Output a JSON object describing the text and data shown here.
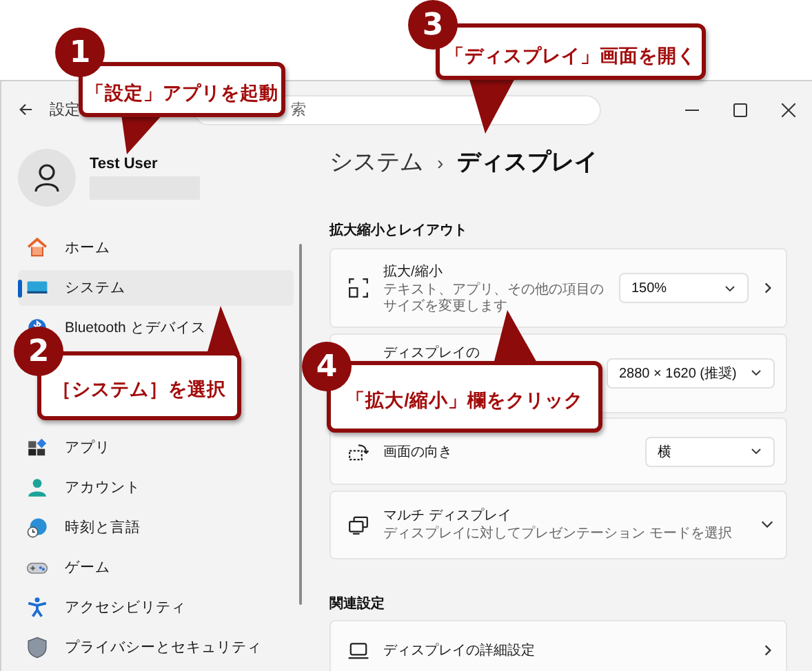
{
  "window": {
    "title": "設定",
    "search": {
      "placeholder": "索"
    }
  },
  "user": {
    "name": "Test User"
  },
  "breadcrumb": {
    "parent": "システム",
    "separator": "›",
    "current": "ディスプレイ"
  },
  "nav": [
    {
      "label": "ホーム",
      "selected": false
    },
    {
      "label": "システム",
      "selected": true
    },
    {
      "label": "Bluetooth とデバイス",
      "selected": false
    },
    {
      "label": "アプリ",
      "selected": false
    },
    {
      "label": "アカウント",
      "selected": false
    },
    {
      "label": "時刻と言語",
      "selected": false
    },
    {
      "label": "ゲーム",
      "selected": false
    },
    {
      "label": "アクセシビリティ",
      "selected": false
    },
    {
      "label": "プライバシーとセキュリティ",
      "selected": false
    }
  ],
  "sections": [
    {
      "heading": "拡大縮小とレイアウト",
      "cards": [
        {
          "kind": "dropdown",
          "title": "拡大/縮小",
          "subtitle": "テキスト、アプリ、その他の項目のサイズを変更します",
          "value": "150%",
          "has_link": true
        },
        {
          "kind": "dropdown",
          "title": "ディスプレイの",
          "value": "2880 × 1620 (推奨)",
          "has_link": false
        },
        {
          "kind": "dropdown",
          "title": "画面の向き",
          "value": "横",
          "has_link": false
        },
        {
          "kind": "expand",
          "title": "マルチ ディスプレイ",
          "subtitle": "ディスプレイに対してプレゼンテーション モードを選択"
        }
      ]
    },
    {
      "heading": "関連設定",
      "cards": [
        {
          "kind": "link",
          "title": "ディスプレイの詳細設定"
        }
      ]
    }
  ],
  "callouts": [
    {
      "number": "1",
      "text": "「設定」アプリを起動"
    },
    {
      "number": "2",
      "text": "［システム］を選択"
    },
    {
      "number": "3",
      "text": "「ディスプレイ」画面を開く"
    },
    {
      "number": "4",
      "text": "「拡大/縮小」欄をクリック"
    }
  ]
}
